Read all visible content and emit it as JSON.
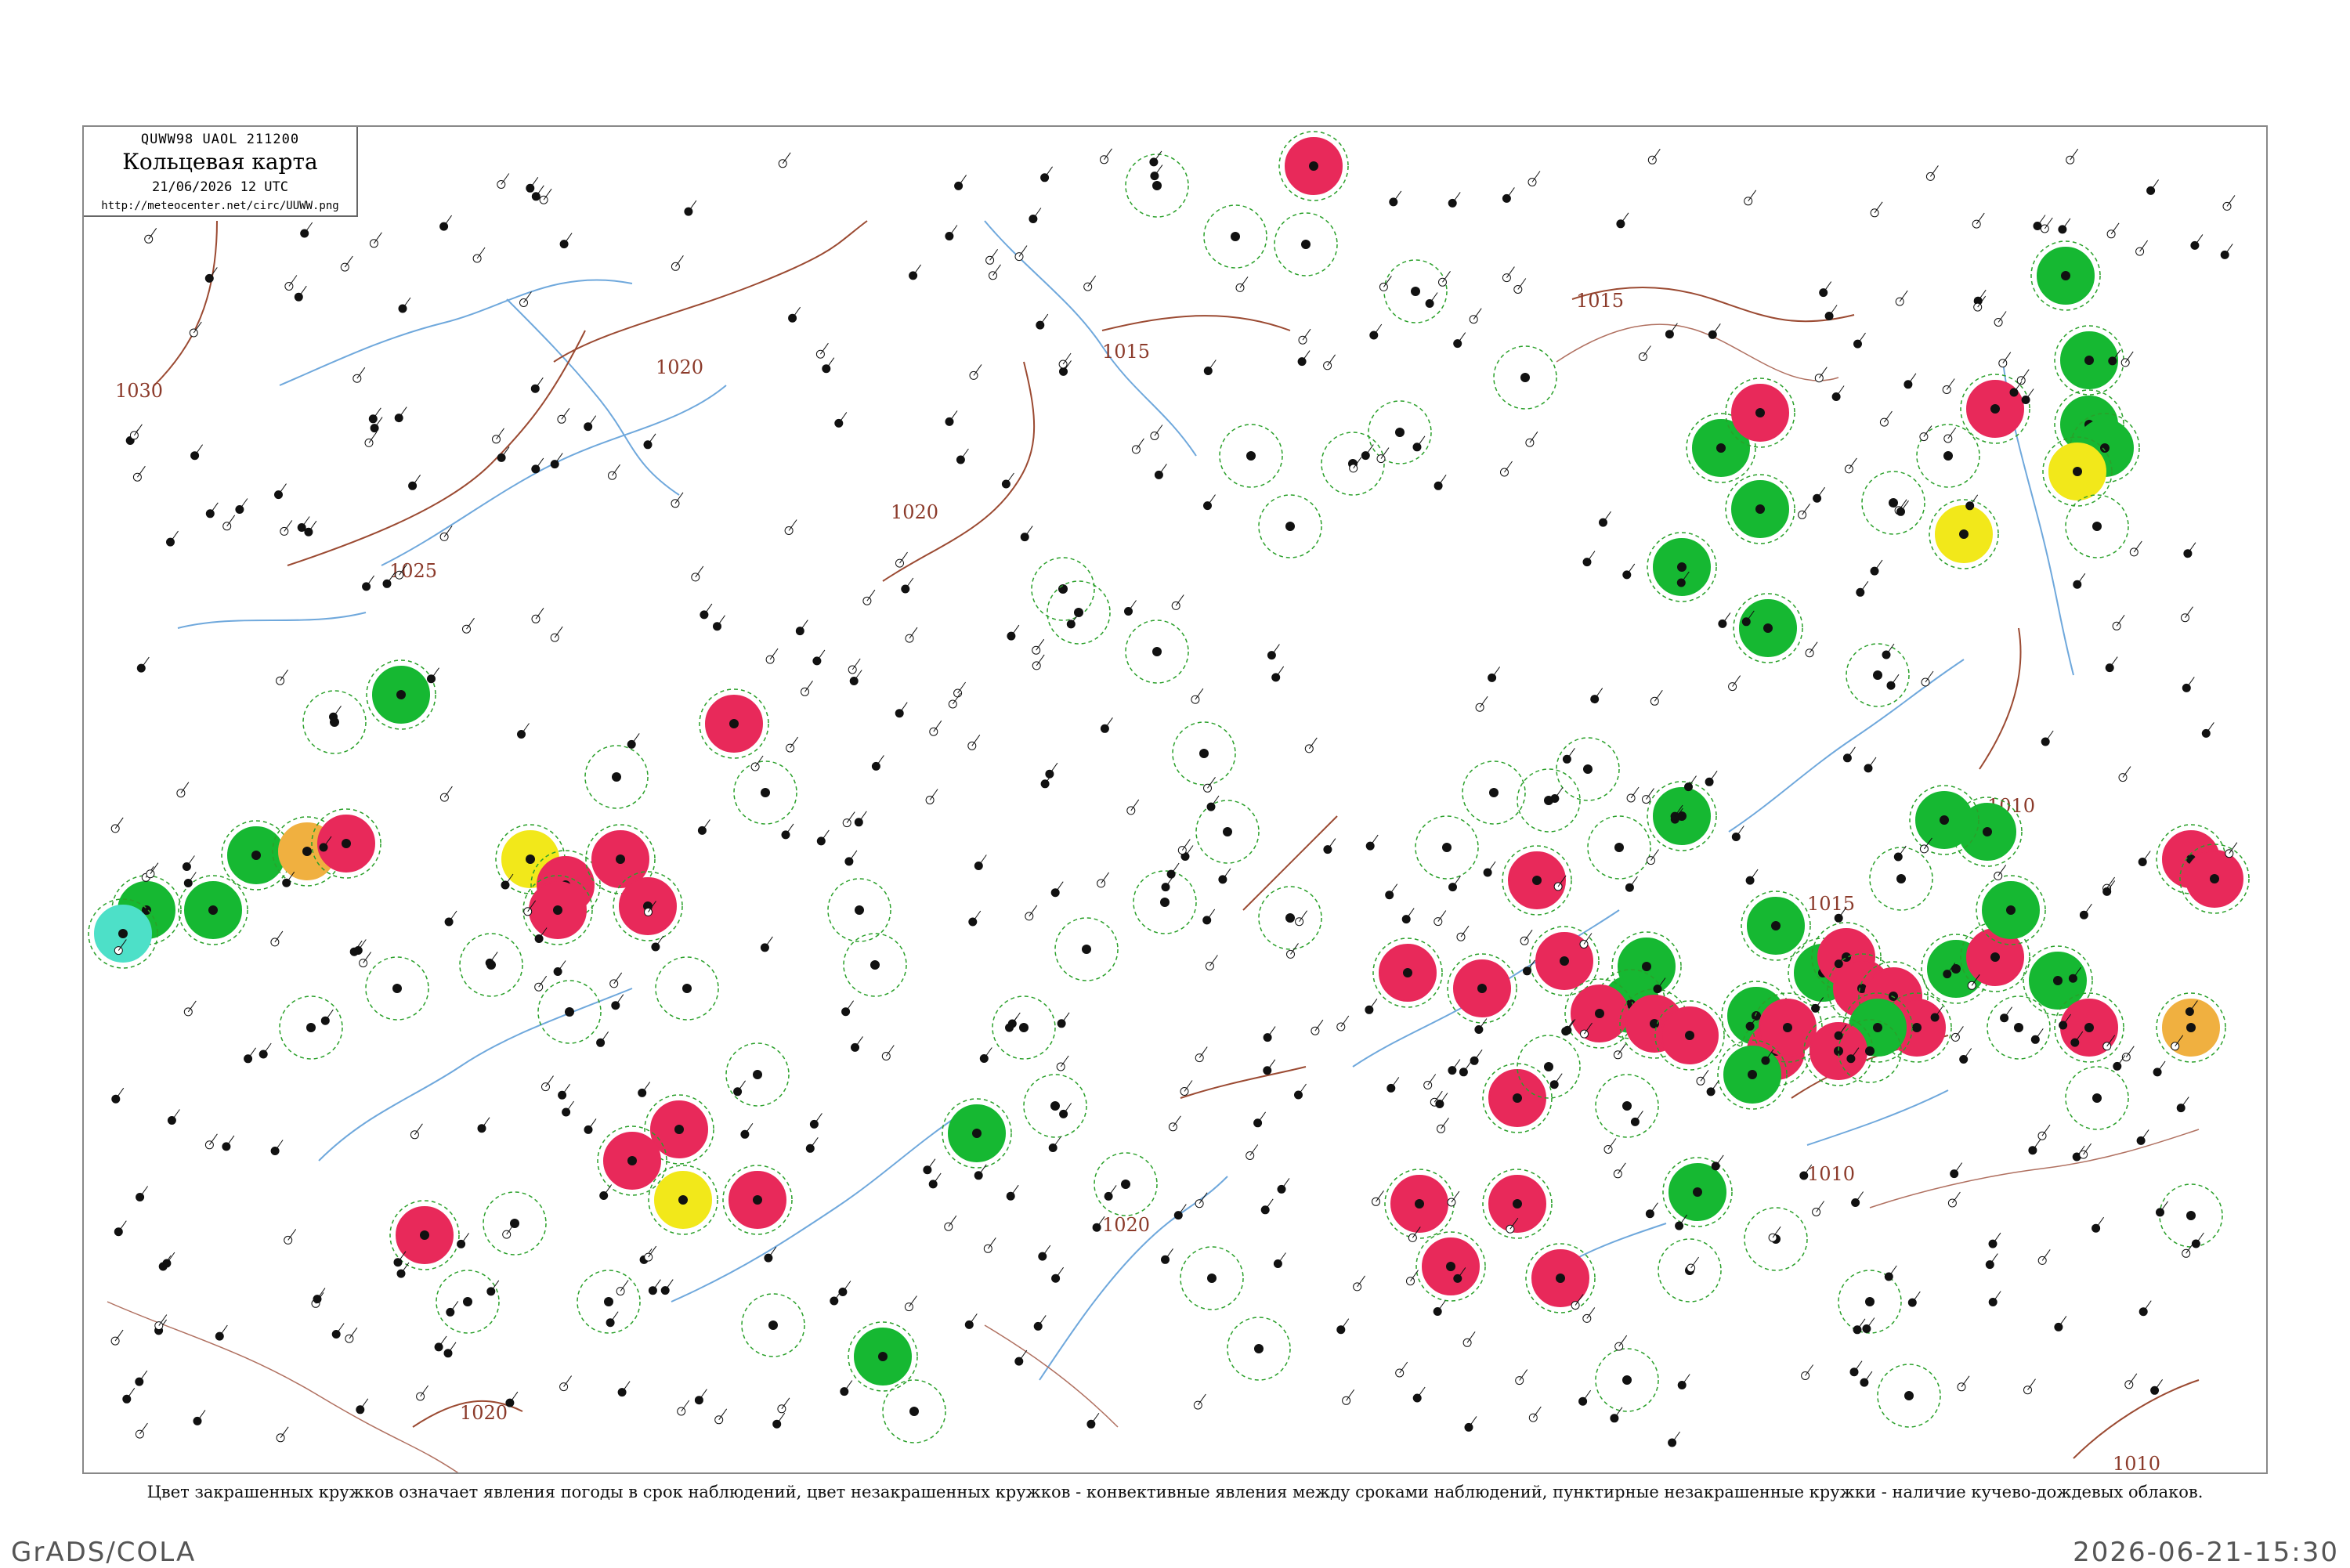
{
  "header": {
    "bulletin": "QUWW98  UAOL  211200",
    "title": "Кольцевая карта",
    "datetime": "21/06/2026 12 UTC",
    "url": "http://meteocenter.net/circ/UUWW.png"
  },
  "caption": "Цвет закрашенных кружков означает явления погоды в срок наблюдений, цвет незакрашенных кружков - конвективные явления между сроками наблюдений, пунктирные незакрашенные кружки - наличие кучево-дождевых облаков.",
  "footer": {
    "left": "GrADS/COLA",
    "right": "2026-06-21-15:30"
  },
  "isobars": [
    "1030",
    "1025",
    "1020",
    "1020",
    "1020",
    "1015",
    "1015",
    "1015",
    "1010",
    "1010",
    "1010",
    "1020"
  ],
  "colors": {
    "thunderstorm": "#e8295a",
    "rain": "#16b832",
    "fog": "#f2e81a",
    "haze": "#f0b040",
    "shower_snow": "#4de0c8",
    "cb_dashed": "#2aa02a",
    "river": "#6fa8dc",
    "isobar": "#9b4a32",
    "border": "#888888"
  },
  "legend_notes": {
    "filled": "weather at observation time",
    "unfilled": "convective phenomena between observations",
    "dashed": "cumulonimbus clouds present"
  }
}
